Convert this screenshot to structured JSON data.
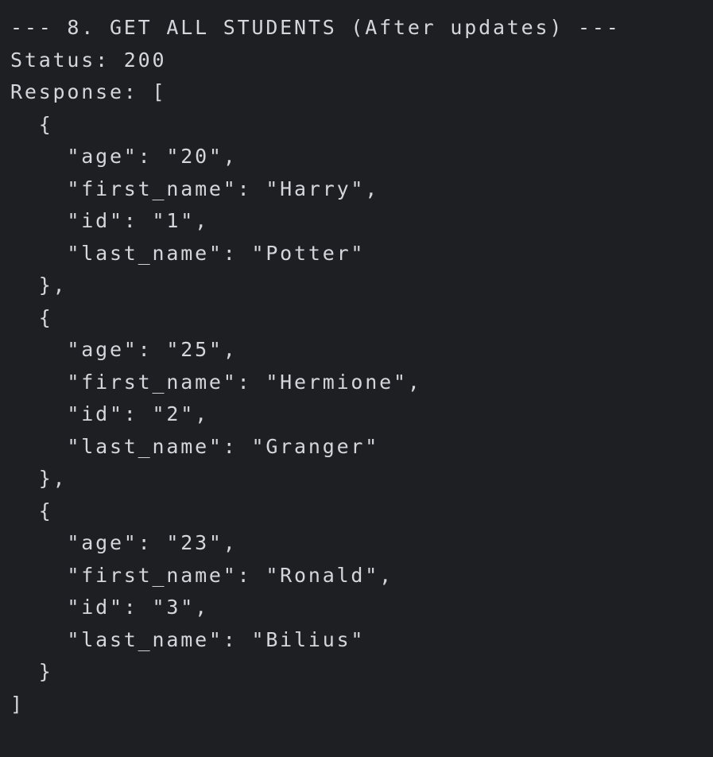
{
  "console": {
    "colors": {
      "background": "#1e1f22",
      "text": "#d4d6db"
    },
    "lines": [
      "--- 8. GET ALL STUDENTS (After updates) ---",
      "Status: 200",
      "Response: [",
      "  {",
      "    \"age\": \"20\",",
      "    \"first_name\": \"Harry\",",
      "    \"id\": \"1\",",
      "    \"last_name\": \"Potter\"",
      "  },",
      "  {",
      "    \"age\": \"25\",",
      "    \"first_name\": \"Hermione\",",
      "    \"id\": \"2\",",
      "    \"last_name\": \"Granger\"",
      "  },",
      "  {",
      "    \"age\": \"23\",",
      "    \"first_name\": \"Ronald\",",
      "    \"id\": \"3\",",
      "    \"last_name\": \"Bilius\"",
      "  }",
      "]"
    ]
  }
}
